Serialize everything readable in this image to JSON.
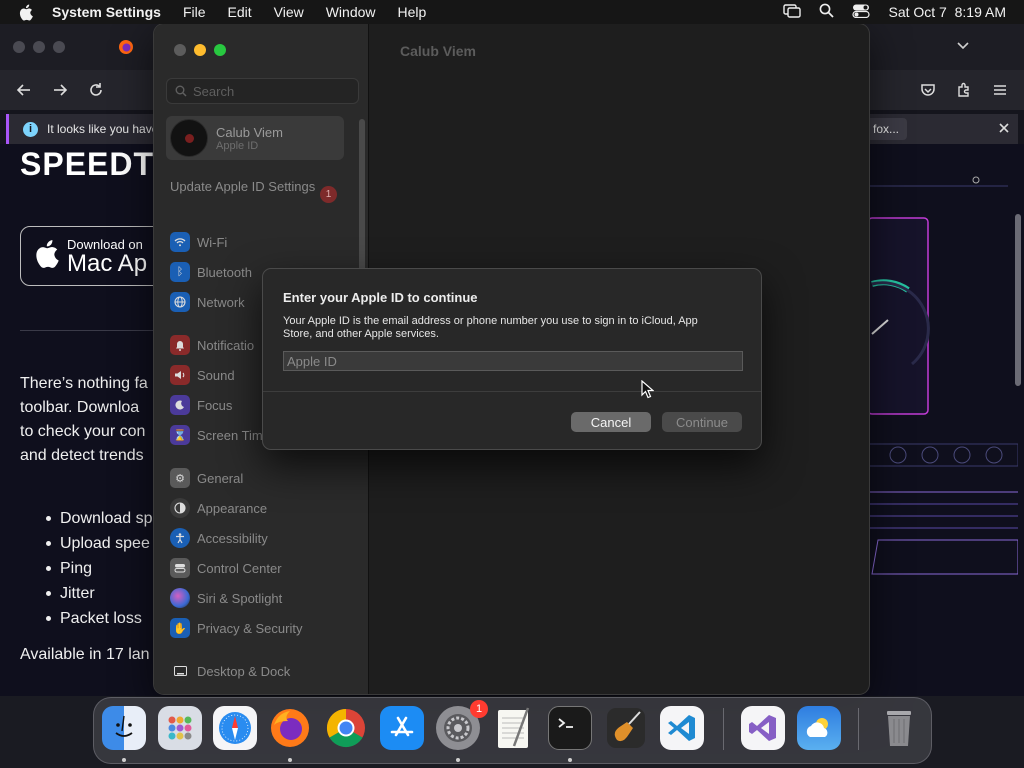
{
  "menubar": {
    "app_name": "System Settings",
    "items": [
      "File",
      "Edit",
      "View",
      "Window",
      "Help"
    ],
    "clock": "Sat Oct 7  8:19 AM"
  },
  "browser": {
    "notice_text": "It looks like you have",
    "notice_suffix": "fox...",
    "page": {
      "headline": "SPEEDT",
      "badge_small": "Download on",
      "badge_big": "Mac Ap",
      "paragraph_lines": [
        "There’s nothing fa",
        "toolbar. Downloa",
        "to check your con",
        "and detect trends"
      ],
      "bullets": [
        "Download sp",
        "Upload spee",
        "Ping",
        "Jitter",
        "Packet loss"
      ],
      "available": "Available in 17 lan"
    }
  },
  "settings": {
    "search_placeholder": "Search",
    "account_name": "Calub Viem",
    "account_sub": "Apple ID",
    "update_label": "Update Apple ID Settings",
    "update_count": "1",
    "content_title": "Calub Viem",
    "sidebar": {
      "wifi": "Wi-Fi",
      "bluetooth": "Bluetooth",
      "network": "Network",
      "notifications": "Notificatio",
      "sound": "Sound",
      "focus": "Focus",
      "screen_time": "Screen Tim",
      "general": "General",
      "appearance": "Appearance",
      "accessibility": "Accessibility",
      "control_center": "Control Center",
      "siri": "Siri & Spotlight",
      "privacy": "Privacy & Security",
      "desktop_dock": "Desktop & Dock"
    }
  },
  "dialog": {
    "title": "Enter your Apple ID to continue",
    "description": "Your Apple ID is the email address or phone number you use to sign in to iCloud, App Store, and other Apple services.",
    "field_placeholder": "Apple ID",
    "field_value": "",
    "cancel_label": "Cancel",
    "continue_label": "Continue"
  },
  "dock": {
    "settings_badge": "1",
    "apps": [
      "finder-icon",
      "launchpad-icon",
      "safari-icon",
      "firefox-icon",
      "chrome-icon",
      "app-store-icon",
      "system-settings-icon",
      "textedit-icon",
      "terminal-icon",
      "garageband-icon",
      "vscode-icon",
      "visual-studio-icon",
      "weather-icon",
      "trash-icon"
    ]
  },
  "colors": {
    "accent_purple": "#a855f7",
    "badge_red": "#ff3b30",
    "traffic_red": "#ff5f57",
    "traffic_yellow": "#febc2e",
    "traffic_green": "#28c840"
  }
}
